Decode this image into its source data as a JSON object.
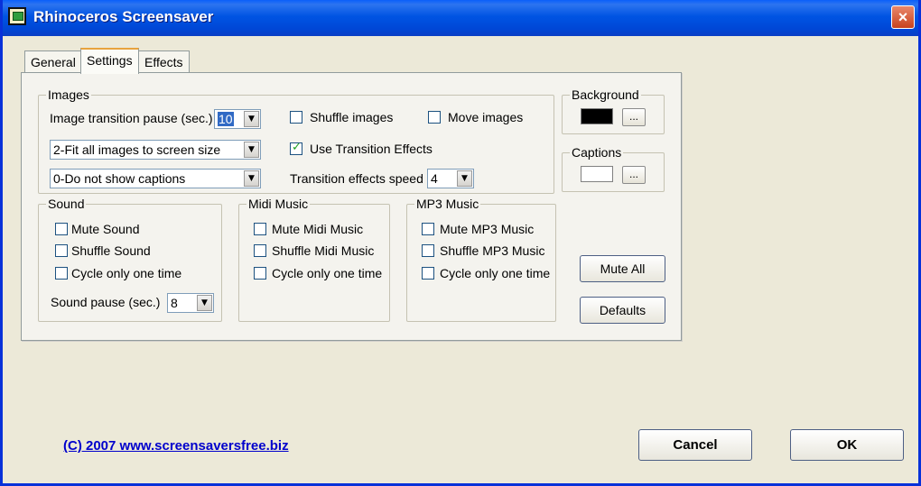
{
  "window": {
    "title": "Rhinoceros Screensaver",
    "close_label": "×"
  },
  "tabs": [
    {
      "label": "General"
    },
    {
      "label": "Settings"
    },
    {
      "label": "Effects"
    }
  ],
  "images": {
    "group_label": "Images",
    "transition_pause_label": "Image transition pause (sec.)",
    "transition_pause_value": "10",
    "fit_select_value": "2-Fit all images to screen size",
    "captions_select_value": "0-Do not show captions",
    "shuffle_images_label": "Shuffle images",
    "shuffle_images_checked": false,
    "move_images_label": "Move images",
    "move_images_checked": false,
    "use_transition_label": "Use Transition Effects",
    "use_transition_checked": true,
    "transition_speed_label": "Transition effects speed",
    "transition_speed_value": "4"
  },
  "background": {
    "group_label": "Background",
    "color": "#000000",
    "button_label": "..."
  },
  "captions": {
    "group_label": "Captions",
    "color": "#ffffff",
    "button_label": "..."
  },
  "sound": {
    "group_label": "Sound",
    "mute_label": "Mute Sound",
    "shuffle_label": "Shuffle Sound",
    "cycle_label": "Cycle only one time",
    "pause_label": "Sound pause (sec.)",
    "pause_value": "8"
  },
  "midi": {
    "group_label": "Midi Music",
    "mute_label": "Mute Midi Music",
    "shuffle_label": "Shuffle Midi Music",
    "cycle_label": "Cycle only one time"
  },
  "mp3": {
    "group_label": "MP3 Music",
    "mute_label": "Mute MP3 Music",
    "shuffle_label": "Shuffle MP3 Music",
    "cycle_label": "Cycle only one time"
  },
  "buttons": {
    "mute_all": "Mute All",
    "defaults": "Defaults",
    "cancel": "Cancel",
    "ok": "OK"
  },
  "footer": {
    "link_text": "(C) 2007 www.screensaversfree.biz"
  },
  "colors": {
    "titlebar": "#0054e3",
    "window_bg": "#ece9d8",
    "link": "#0000cc"
  }
}
